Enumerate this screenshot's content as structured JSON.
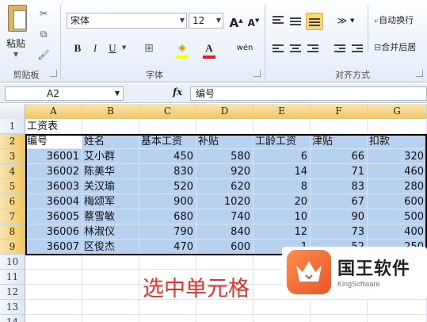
{
  "ribbon": {
    "clipboard": {
      "paste_label": "粘贴",
      "group_label": "剪贴板"
    },
    "font": {
      "font_name": "宋体",
      "font_size": "12",
      "group_label": "字体",
      "bold": "B",
      "italic": "I",
      "underline": "U",
      "grow": "A",
      "shrink": "A",
      "pinyin": "wén"
    },
    "alignment": {
      "wrap_label": "自动换行",
      "merge_label": "合并后居",
      "group_label": "对齐方式"
    }
  },
  "formula_bar": {
    "name_box": "A2",
    "fx": "fx",
    "formula": "编号"
  },
  "columns": [
    "A",
    "B",
    "C",
    "D",
    "E",
    "F",
    "G"
  ],
  "rows": [
    "1",
    "2",
    "3",
    "4",
    "5",
    "6",
    "7",
    "8",
    "9",
    "10",
    "11",
    "12",
    "13",
    "14"
  ],
  "sheet": {
    "title": "工资表",
    "headers": [
      "编号",
      "姓名",
      "基本工资",
      "补贴",
      "工龄工资",
      "津贴",
      "扣款"
    ],
    "data": [
      [
        "36001",
        "艾小群",
        "450",
        "580",
        "6",
        "66",
        "320"
      ],
      [
        "36002",
        "陈美华",
        "830",
        "920",
        "14",
        "71",
        "460"
      ],
      [
        "36003",
        "关汉瑜",
        "520",
        "620",
        "8",
        "83",
        "280"
      ],
      [
        "36004",
        "梅颂军",
        "900",
        "1020",
        "20",
        "67",
        "600"
      ],
      [
        "36005",
        "蔡雪敏",
        "680",
        "740",
        "10",
        "90",
        "500"
      ],
      [
        "36006",
        "林淑仪",
        "790",
        "840",
        "12",
        "73",
        "400"
      ],
      [
        "36007",
        "区俊杰",
        "470",
        "600",
        "1",
        "52",
        "250"
      ]
    ]
  },
  "caption": "选中单元格",
  "watermark": {
    "title": "国王软件",
    "subtitle": "KingSoftware"
  },
  "colors": {
    "selection": "#b7d1ef",
    "caption": "#e0332b",
    "active_button": "#fbd776"
  }
}
